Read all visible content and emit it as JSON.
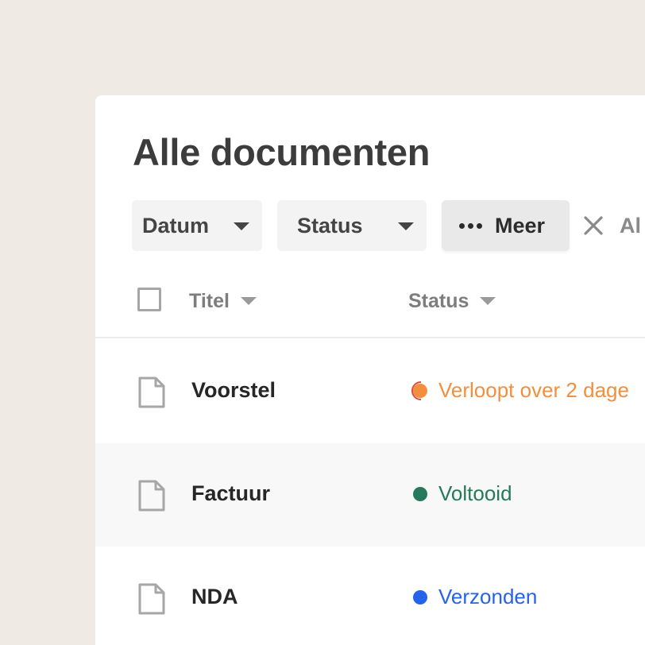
{
  "page": {
    "title": "Alle documenten"
  },
  "filters": {
    "date_label": "Datum",
    "status_label": "Status",
    "more_label": "Meer",
    "clear_label": "Al"
  },
  "table": {
    "columns": [
      "Titel",
      "Status"
    ],
    "rows": [
      {
        "title": "Voorstel",
        "status": "Verloopt over 2 dage",
        "status_color": "#f28f3f"
      },
      {
        "title": "Factuur",
        "status": "Voltooid",
        "status_color": "#267a5a"
      },
      {
        "title": "NDA",
        "status": "Verzonden",
        "status_color": "#2563eb"
      }
    ]
  },
  "colors": {
    "background": "#efebe4",
    "panel": "#ffffff",
    "expiring": "#f28f3f",
    "completed": "#267a5a",
    "sent": "#2563eb"
  },
  "icons": {
    "filter_dropdown": "caret-down-icon",
    "more": "dots-icon",
    "clear": "close-icon",
    "document": "file-icon"
  }
}
